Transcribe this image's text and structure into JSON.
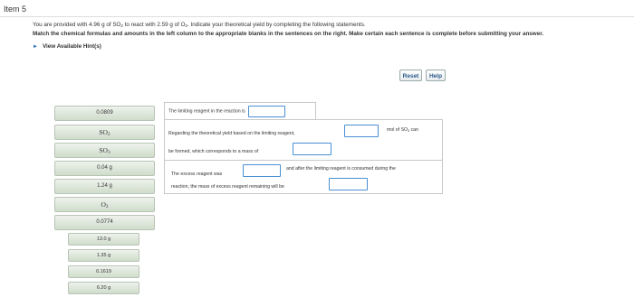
{
  "item_title": "Item 5",
  "problem": {
    "text_before_so2": "You are provided with 4.96 g of SO",
    "text_react": " to react with 2.59 g of O",
    "text_after": ". Indicate your theoretical yield by completing the following statements.",
    "instruction": "Match the chemical formulas and amounts in the left column to the appropriate blanks in the sentences on the right. Make certain each sentence is complete before submitting your answer."
  },
  "hints_label": "View Available Hint(s)",
  "buttons": {
    "reset": "Reset",
    "help": "Help"
  },
  "chips": [
    "0.0809",
    "SO",
    "SO",
    "0.04 g",
    "1.24 g",
    "O",
    "0.0774",
    "13.0 g",
    "1.35 g",
    "0.1619",
    "6.20 g"
  ],
  "formula_subscripts": {
    "so2": "2",
    "so3": "3",
    "o2": "2"
  },
  "sentences": {
    "s1": {
      "text": "The limiting reagent in the reaction is"
    },
    "s2": {
      "part1": "Regarding the theoretical yield based on the limiting reagent,",
      "part2": "mol of SO",
      "part2_sub": "3",
      "part3": "can",
      "part4": "be formed, which corresponds to a mass of"
    },
    "s3": {
      "part1": "The excess reagent was",
      "part2": "and after the limiting reagent is consumed during the",
      "part3": "reaction, the mass of excess reagent remaining will be"
    }
  }
}
